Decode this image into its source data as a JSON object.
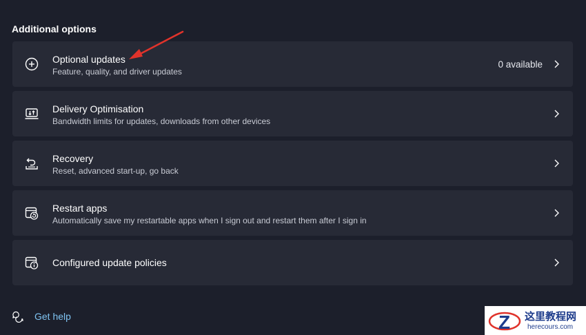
{
  "section": {
    "title": "Additional options"
  },
  "options": [
    {
      "icon": "plus-circle-icon",
      "title": "Optional updates",
      "subtitle": "Feature, quality, and driver updates",
      "status": "0 available"
    },
    {
      "icon": "delivery-optimisation-icon",
      "title": "Delivery Optimisation",
      "subtitle": "Bandwidth limits for updates, downloads from other devices"
    },
    {
      "icon": "recovery-icon",
      "title": "Recovery",
      "subtitle": "Reset, advanced start-up, go back"
    },
    {
      "icon": "restart-apps-icon",
      "title": "Restart apps",
      "subtitle": "Automatically save my restartable apps when I sign out and restart them after I sign in"
    },
    {
      "icon": "policy-icon",
      "title": "Configured update policies"
    }
  ],
  "help": {
    "label": "Get help"
  },
  "watermark": {
    "title": "这里教程网",
    "url": "herecours.com"
  },
  "colors": {
    "background": "#1c1f2b",
    "card": "#272a36",
    "link": "#7fc3f2",
    "annotation": "#e0332b",
    "watermark_text": "#1e3c8c"
  }
}
